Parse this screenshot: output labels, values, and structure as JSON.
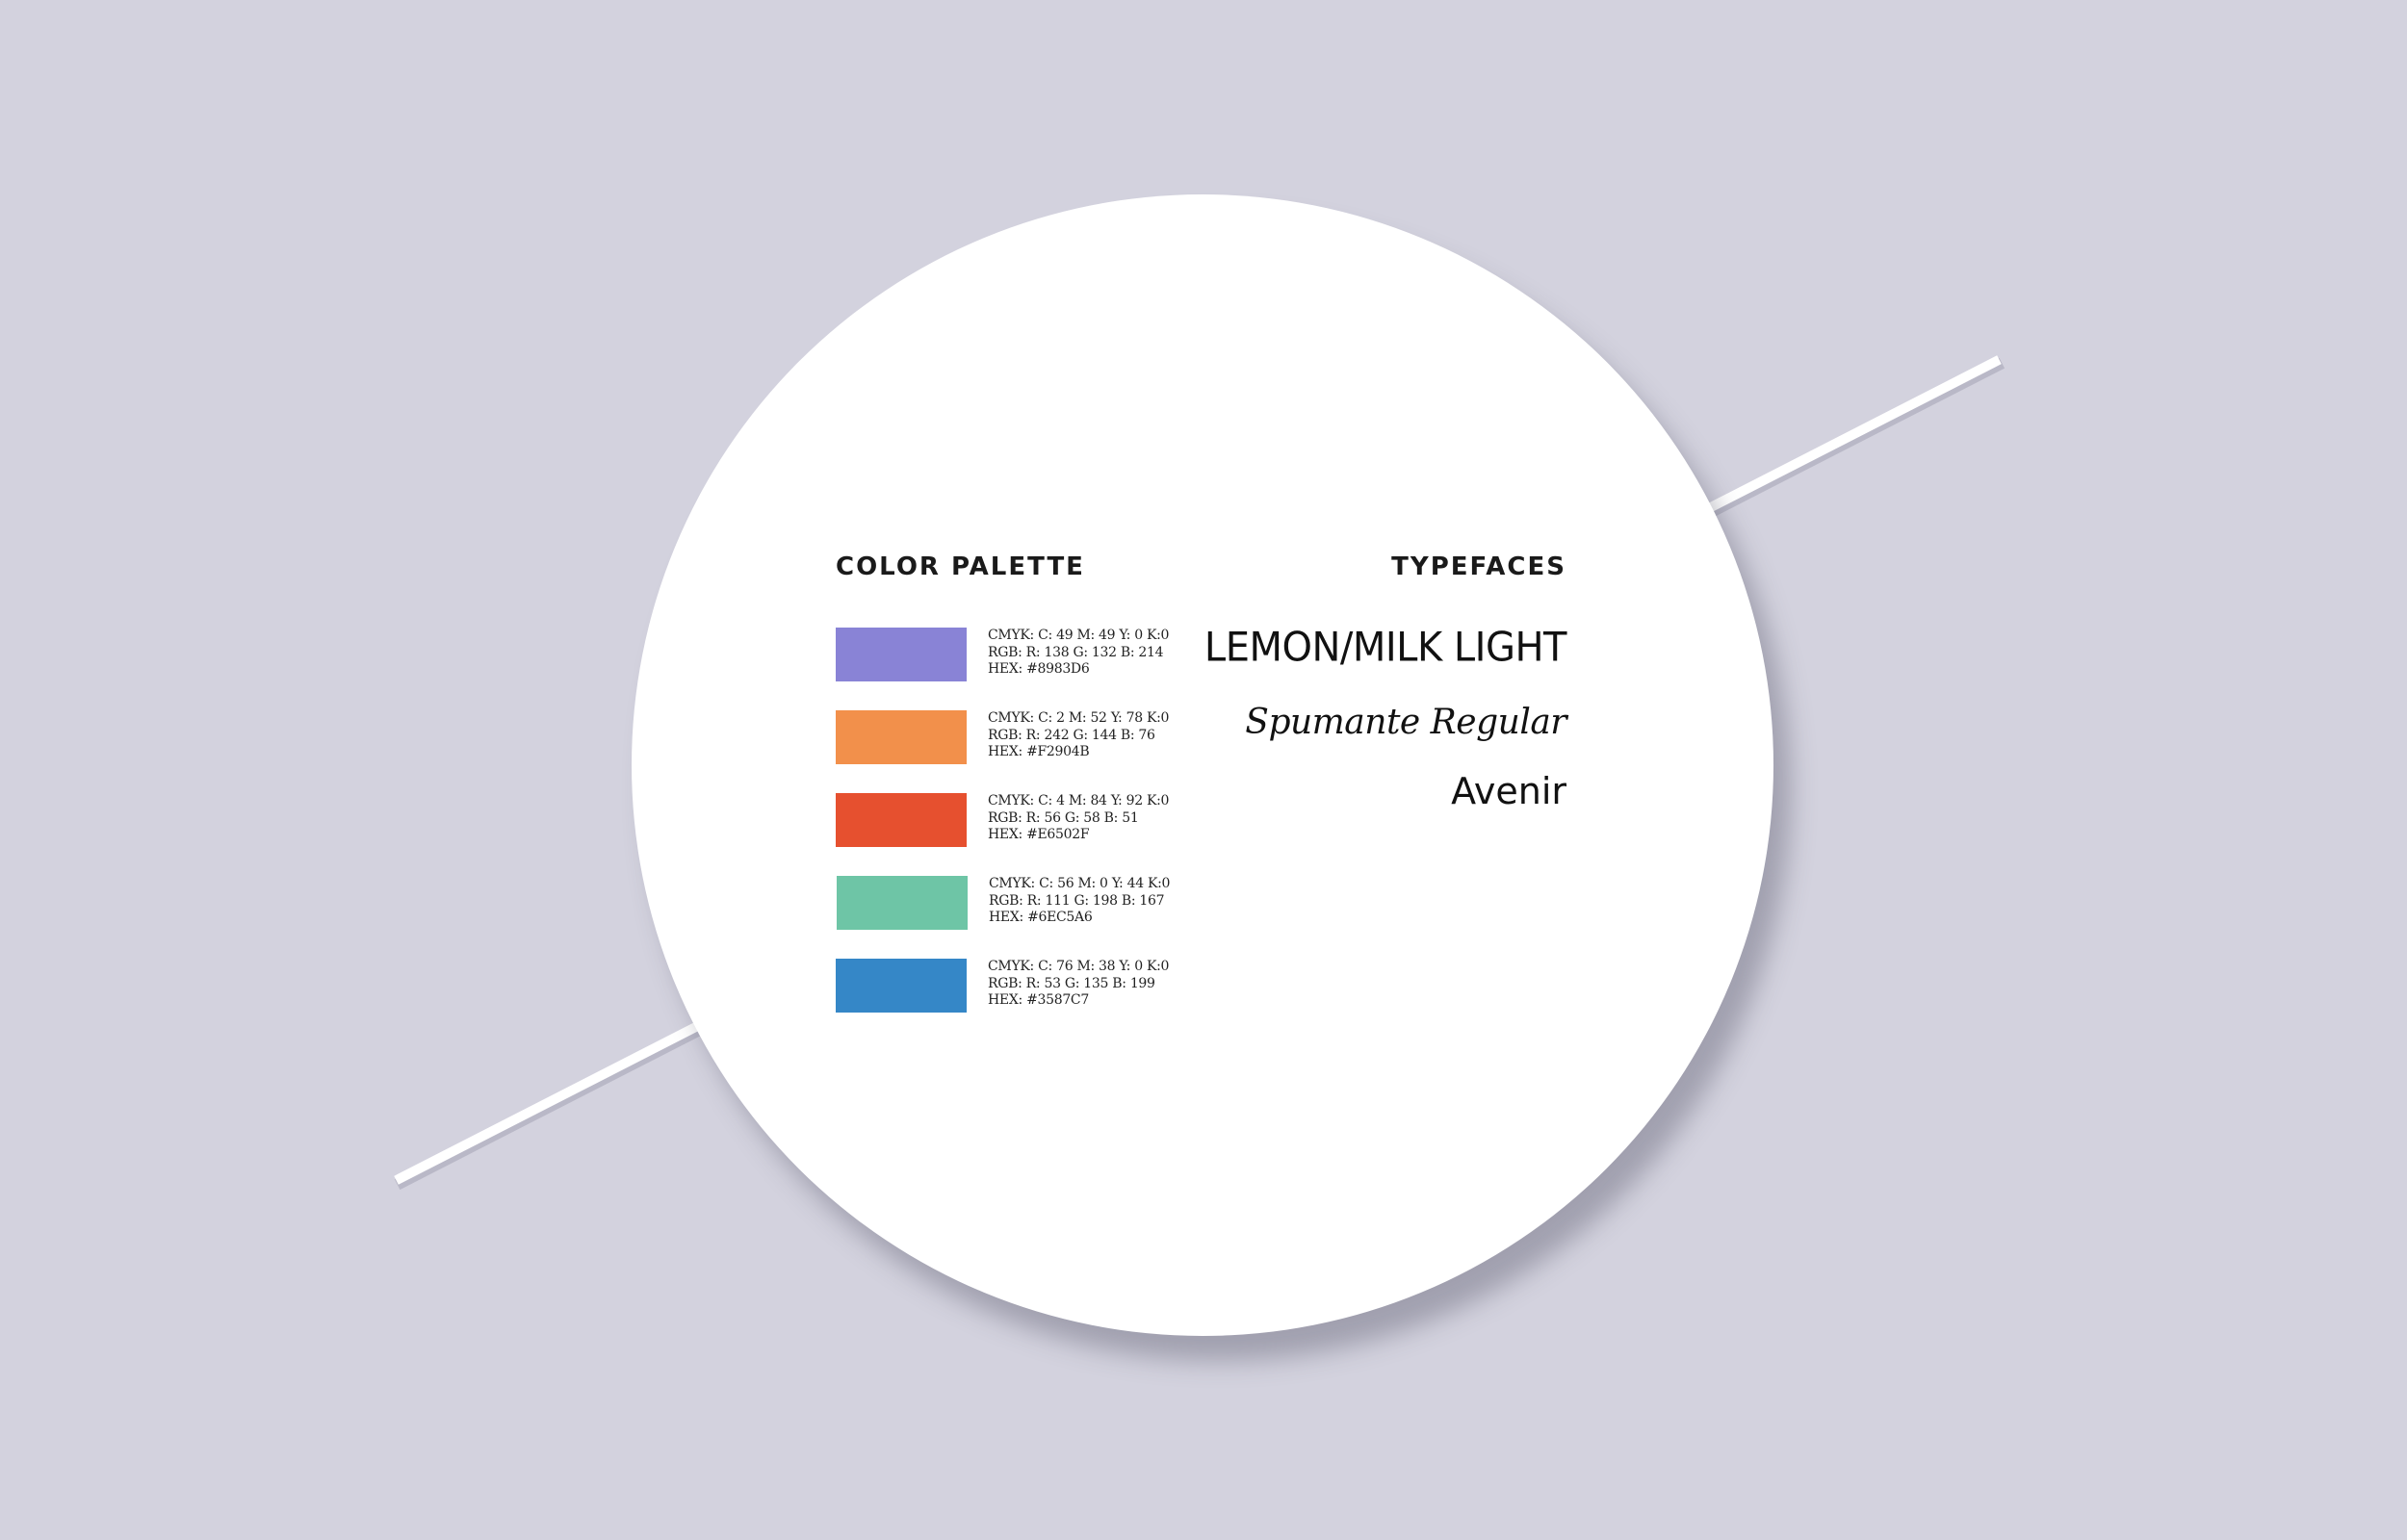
{
  "background_color": "#d3d2de",
  "color_palette": {
    "title": "COLOR PALETTE",
    "swatches": [
      {
        "color": "#8983D6",
        "cmyk": "CMYK: C: 49 M: 49 Y: 0 K:0",
        "rgb": "RGB: R: 138 G: 132 B: 214",
        "hex": "HEX: #8983D6"
      },
      {
        "color": "#F2904B",
        "cmyk": "CMYK: C: 2 M: 52 Y: 78 K:0",
        "rgb": "RGB: R: 242 G: 144 B: 76",
        "hex": "HEX: #F2904B"
      },
      {
        "color": "#E6502F",
        "cmyk": "CMYK: C: 4 M: 84 Y: 92 K:0",
        "rgb": "RGB: R: 56 G: 58 B: 51",
        "hex": "HEX: #E6502F"
      },
      {
        "color": "#6EC5A6",
        "cmyk": "CMYK: C: 56 M: 0 Y: 44 K:0",
        "rgb": "RGB: R: 111 G: 198 B: 167",
        "hex": "HEX: #6EC5A6"
      },
      {
        "color": "#3587C7",
        "cmyk": "CMYK: C: 76 M: 38 Y: 0 K:0",
        "rgb": "RGB: R: 53 G: 135 B: 199",
        "hex": "HEX: #3587C7"
      }
    ]
  },
  "typefaces": {
    "title": "TYPEFACES",
    "items": [
      {
        "name": "LEMON/MILK LIGHT"
      },
      {
        "name": "Spumante Regular"
      },
      {
        "name": "Avenir"
      }
    ]
  }
}
